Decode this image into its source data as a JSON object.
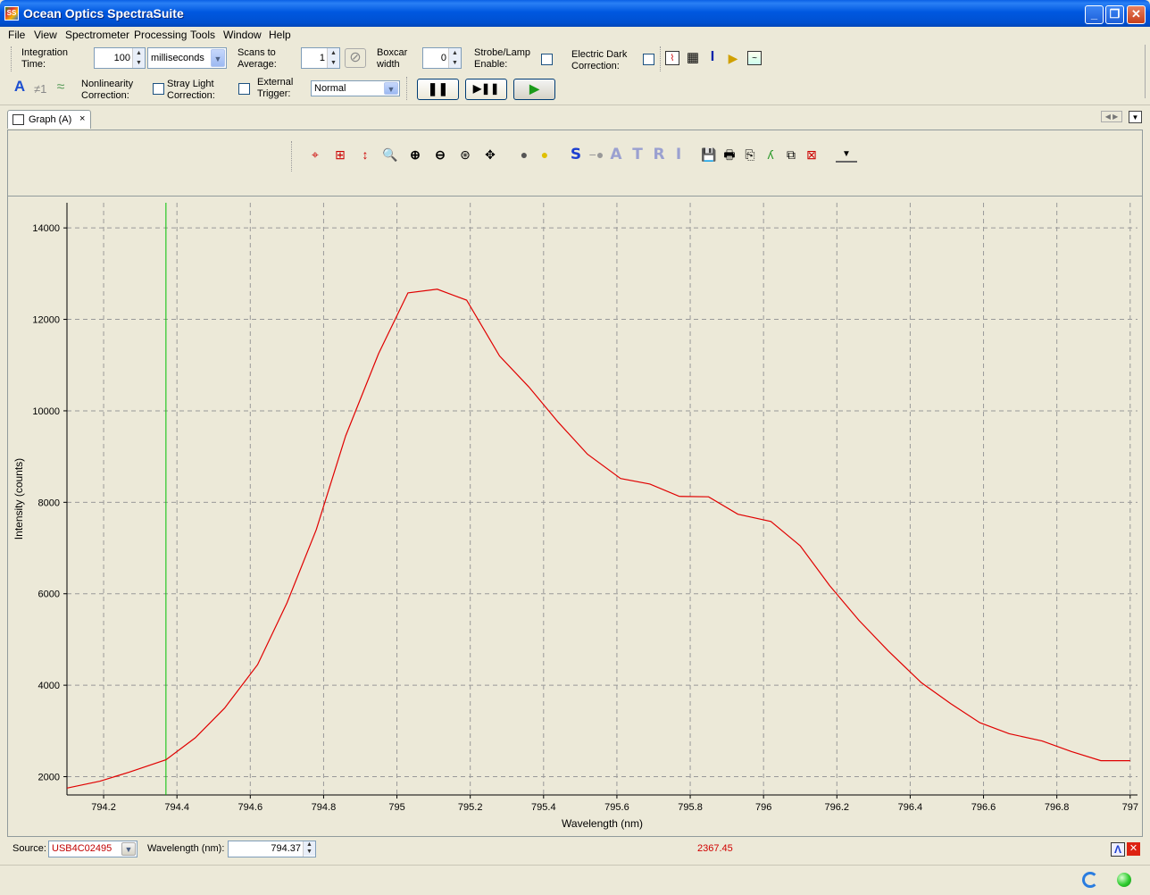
{
  "window": {
    "title": "Ocean Optics SpectraSuite",
    "app_icon_text": "SS"
  },
  "menu": [
    "File",
    "View",
    "Spectrometer",
    "Processing",
    "Tools",
    "Window",
    "Help"
  ],
  "toolbar": {
    "integration_time_label_1": "Integration",
    "integration_time_label_2": "Time:",
    "integration_time_value": "100",
    "integration_unit": "milliseconds",
    "scans_label_1": "Scans to",
    "scans_label_2": "Average:",
    "scans_value": "1",
    "boxcar_label_1": "Boxcar",
    "boxcar_label_2": "width",
    "boxcar_value": "0",
    "strobe_label_1": "Strobe/Lamp",
    "strobe_label_2": "Enable:",
    "dark_label_1": "Electric Dark",
    "dark_label_2": "Correction:",
    "nonlin_label_1": "Nonlinearity",
    "nonlin_label_2": "Correction:",
    "stray_label_1": "Stray Light",
    "stray_label_2": "Correction:",
    "trigger_label_1": "External",
    "trigger_label_2": "Trigger:",
    "trigger_mode": "Normal",
    "neq1": "≠1"
  },
  "tab": {
    "label": "Graph (A)",
    "close": "×"
  },
  "graph_toolbar_letters": [
    "S",
    "A",
    "T",
    "R",
    "I"
  ],
  "source": {
    "label": "Source:",
    "value": "USB4C02495",
    "wavelength_label": "Wavelength (nm):",
    "wavelength_value": "794.37",
    "cursor_intensity": "2367.45"
  },
  "colors": {
    "trace": "#E00000",
    "cursor": "#00C000",
    "grid": "#999999",
    "source_text": "#C00000"
  },
  "chart_data": {
    "type": "line",
    "xlabel": "Wavelength (nm)",
    "ylabel": "Intensity (counts)",
    "xlim": [
      794.1,
      797.02
    ],
    "ylim": [
      1600,
      14550
    ],
    "x_ticks": [
      794.2,
      794.4,
      794.6,
      794.8,
      795,
      795.2,
      795.4,
      795.6,
      795.8,
      796,
      796.2,
      796.4,
      796.6,
      796.8,
      797
    ],
    "x_tick_labels": [
      "794.2",
      "794.4",
      "794.6",
      "794.8",
      "795",
      "795.2",
      "795.4",
      "795.6",
      "795.8",
      "796",
      "796.2",
      "796.4",
      "796.6",
      "796.8",
      "797"
    ],
    "y_ticks": [
      2000,
      4000,
      6000,
      8000,
      10000,
      12000,
      14000
    ],
    "y_tick_labels": [
      "2000",
      "4000",
      "6000",
      "8000",
      "10000",
      "12000",
      "14000"
    ],
    "grid": true,
    "cursor_x": 794.37,
    "series": [
      {
        "x": [
          794.1,
          794.19,
          794.27,
          794.37,
          794.45,
          794.53,
          794.62,
          794.7,
          794.78,
          794.86,
          794.95,
          795.03,
          795.11,
          795.19,
          795.28,
          795.36,
          795.44,
          795.52,
          795.61,
          795.69,
          795.77,
          795.85,
          795.93,
          796.02,
          796.1,
          796.18,
          796.26,
          796.34,
          796.43,
          796.51,
          796.59,
          796.67,
          796.76,
          796.84,
          796.92,
          797.0
        ],
        "y": [
          1750,
          1900,
          2100,
          2370,
          2850,
          3500,
          4450,
          5800,
          7400,
          9450,
          11250,
          12580,
          12660,
          12420,
          11200,
          10520,
          9750,
          9050,
          8520,
          8400,
          8130,
          8120,
          7740,
          7580,
          7050,
          6180,
          5420,
          4750,
          4060,
          3600,
          3180,
          2940,
          2780,
          2550,
          2350,
          2350
        ]
      }
    ]
  }
}
